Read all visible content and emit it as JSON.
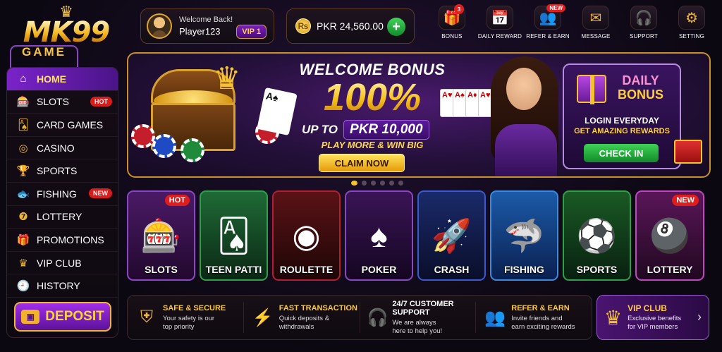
{
  "logo": {
    "line1": "MK99",
    "line2": "GAME"
  },
  "user": {
    "welcome": "Welcome Back!",
    "name": "Player123",
    "vip": "VIP 1"
  },
  "wallet": {
    "balance": "PKR 24,560.00",
    "add_icon": "plus-icon"
  },
  "top_icons": [
    {
      "label": "BONUS",
      "icon": "gift-icon",
      "badge": "3"
    },
    {
      "label": "DAILY REWARD",
      "icon": "calendar-icon"
    },
    {
      "label": "REFER & EARN",
      "icon": "users-icon",
      "badge": "NEW"
    },
    {
      "label": "MESSAGE",
      "icon": "envelope-icon"
    },
    {
      "label": "SUPPORT",
      "icon": "headset-icon"
    },
    {
      "label": "SETTING",
      "icon": "gear-icon"
    }
  ],
  "sidebar": {
    "items": [
      {
        "label": "HOME",
        "icon": "home-icon",
        "active": true
      },
      {
        "label": "SLOTS",
        "icon": "slot-machine-icon",
        "tag": "HOT"
      },
      {
        "label": "CARD GAMES",
        "icon": "cards-icon"
      },
      {
        "label": "CASINO",
        "icon": "roulette-icon"
      },
      {
        "label": "SPORTS",
        "icon": "trophy-icon"
      },
      {
        "label": "FISHING",
        "icon": "fish-icon",
        "tag": "NEW"
      },
      {
        "label": "LOTTERY",
        "icon": "lottery-ball-icon"
      },
      {
        "label": "PROMOTIONS",
        "icon": "gift-icon"
      },
      {
        "label": "VIP CLUB",
        "icon": "crown-icon"
      },
      {
        "label": "HISTORY",
        "icon": "history-icon"
      }
    ],
    "deposit": "DEPOSIT"
  },
  "banner": {
    "title": "WELCOME BONUS",
    "percent": "100%",
    "up_to": "UP TO",
    "amount": "PKR 10,000",
    "tagline": "PLAY MORE & WIN BIG",
    "cta": "CLAIM NOW",
    "daily": {
      "title_1": "DAILY",
      "title_2": "BONUS",
      "line1": "LOGIN EVERYDAY",
      "line2": "GET AMAZING REWARDS",
      "cta": "CHECK IN"
    },
    "slides": 6,
    "active_slide": 1
  },
  "games": [
    {
      "name": "SLOTS",
      "tag": "HOT",
      "icon": "slot-machine-icon"
    },
    {
      "name": "TEEN PATTI",
      "icon": "cards-icon"
    },
    {
      "name": "ROULETTE",
      "icon": "roulette-icon"
    },
    {
      "name": "POKER",
      "icon": "poker-icon"
    },
    {
      "name": "CRASH",
      "icon": "rocket-icon"
    },
    {
      "name": "FISHING",
      "icon": "shark-icon"
    },
    {
      "name": "SPORTS",
      "icon": "soccer-ball-icon"
    },
    {
      "name": "LOTTERY",
      "tag": "NEW",
      "icon": "lottery-ball-icon"
    }
  ],
  "features": [
    {
      "title": "SAFE & SECURE",
      "desc1": "Your safety is our",
      "desc2": "top priority",
      "icon": "shield-icon"
    },
    {
      "title": "FAST TRANSACTION",
      "desc1": "Quick deposits &",
      "desc2": "withdrawals",
      "icon": "lightning-icon"
    },
    {
      "title": "24/7 CUSTOMER SUPPORT",
      "desc1": "We are always",
      "desc2": "here to help you!",
      "icon": "headset-icon"
    },
    {
      "title": "REFER & EARN",
      "desc1": "Invite friends and",
      "desc2": "earn exciting rewards",
      "icon": "users-icon"
    }
  ],
  "vip_club": {
    "title": "VIP CLUB",
    "desc1": "Exclusive benefits",
    "desc2": "for VIP members"
  }
}
